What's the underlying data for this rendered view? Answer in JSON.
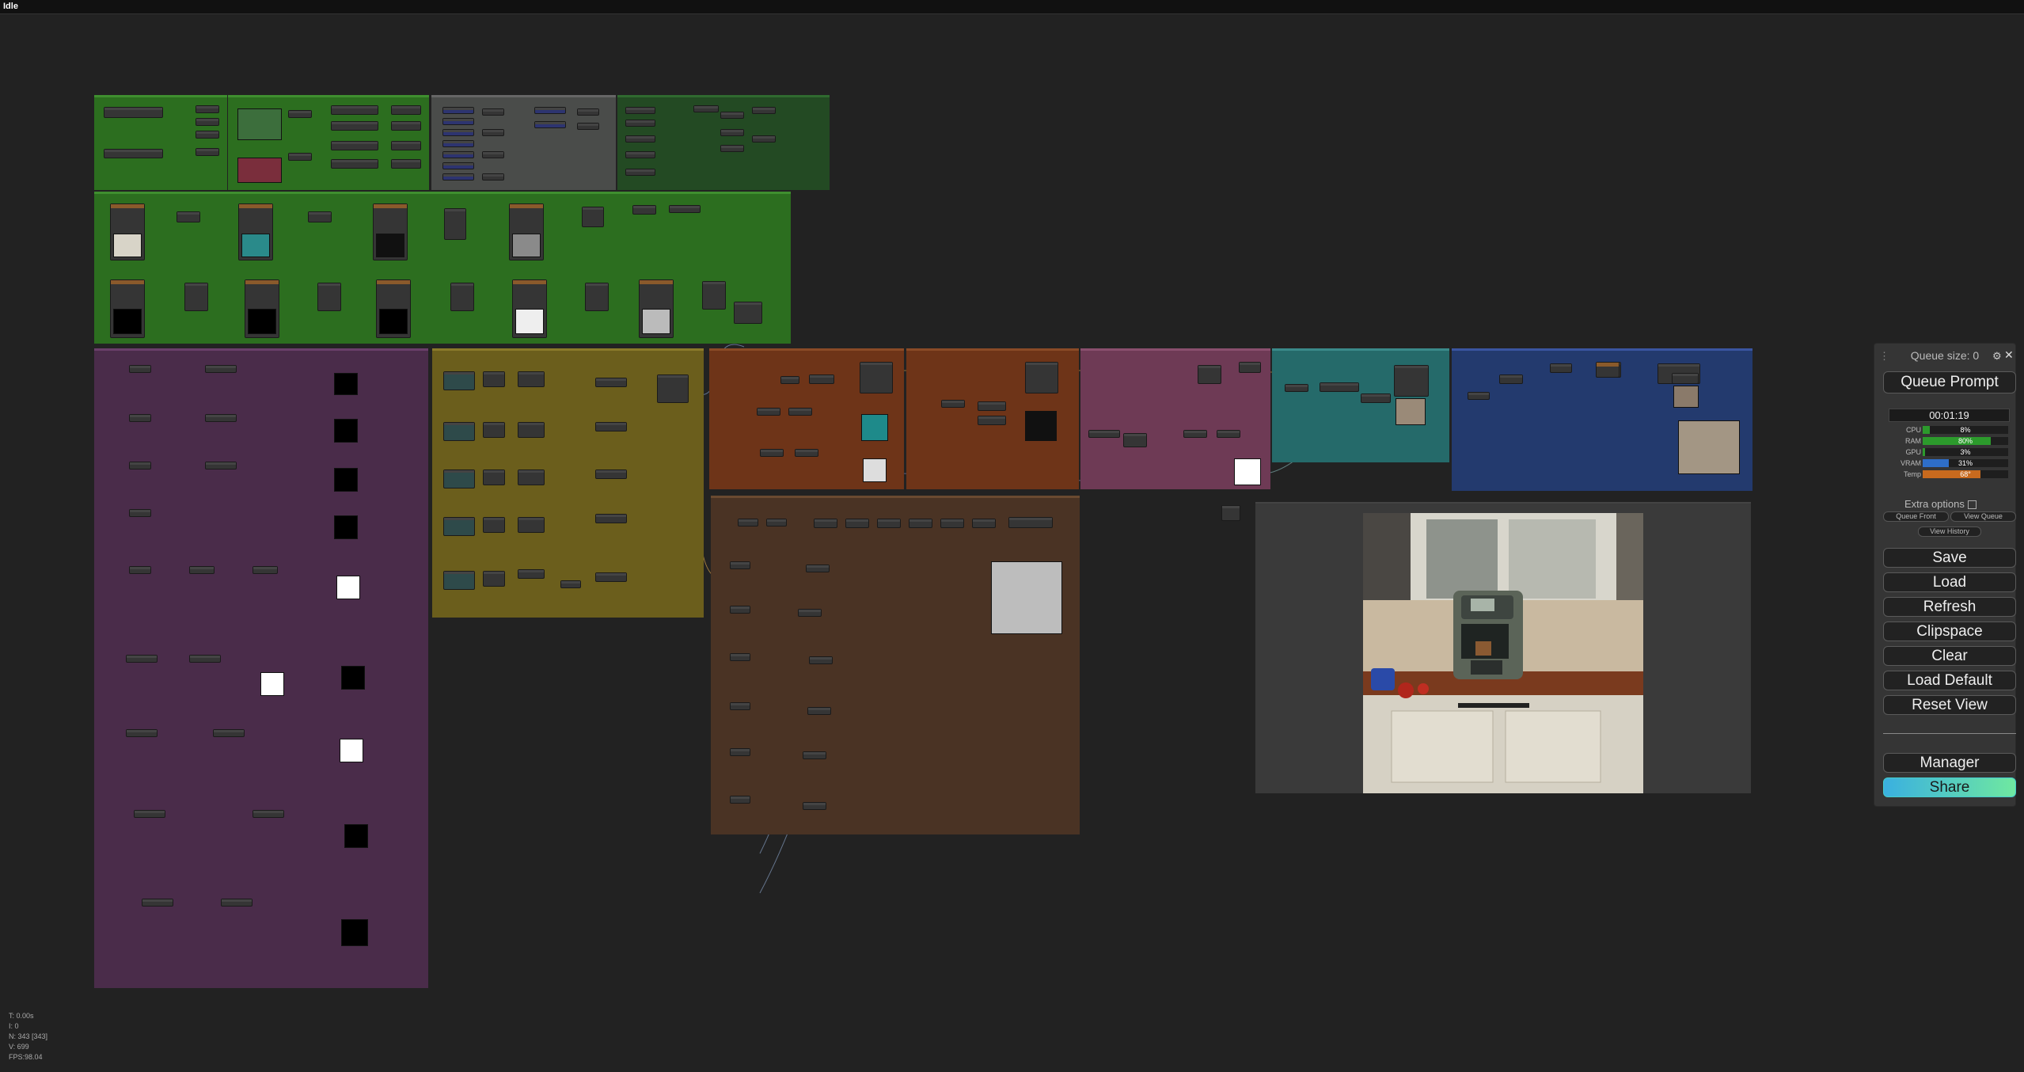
{
  "window": {
    "title": "Idle"
  },
  "stats": {
    "t": "T: 0.00s",
    "i": "I: 0",
    "n": "N: 343 [343]",
    "v": "V: 699",
    "fps": "FPS:98.04"
  },
  "menu": {
    "queue_size": "Queue size: 0",
    "queue_prompt": "Queue Prompt",
    "timer": "00:01:19",
    "monitor": [
      {
        "label": "CPU",
        "value": "8%",
        "percent": 8,
        "color": "#2c9a2c"
      },
      {
        "label": "RAM",
        "value": "80%",
        "percent": 80,
        "color": "#2c9a2c"
      },
      {
        "label": "GPU",
        "value": "3%",
        "percent": 3,
        "color": "#2c9a2c"
      },
      {
        "label": "VRAM",
        "value": "31%",
        "percent": 31,
        "color": "#2e6ec8"
      },
      {
        "label": "Temp",
        "value": "68°",
        "percent": 68,
        "color": "#c86a1e"
      }
    ],
    "extra_options": "Extra options",
    "queue_front": "Queue Front",
    "view_queue": "View Queue",
    "view_history": "View History",
    "save": "Save",
    "load": "Load",
    "refresh": "Refresh",
    "clipspace": "Clipspace",
    "clear": "Clear",
    "load_default": "Load Default",
    "reset_view": "Reset View",
    "manager": "Manager",
    "share": "Share"
  },
  "group_colors": {
    "green": "#2c6e1f",
    "gray": "#4a4c4a",
    "dark_green": "#234a23",
    "purple": "#4a2c4a",
    "yellow": "#6b5e1c",
    "rust": "#6e3418",
    "mauve": "#6e3a55",
    "teal": "#256a6a",
    "blue": "#233a6e",
    "brown": "#4a3324",
    "preview": "#3a3a3a"
  }
}
